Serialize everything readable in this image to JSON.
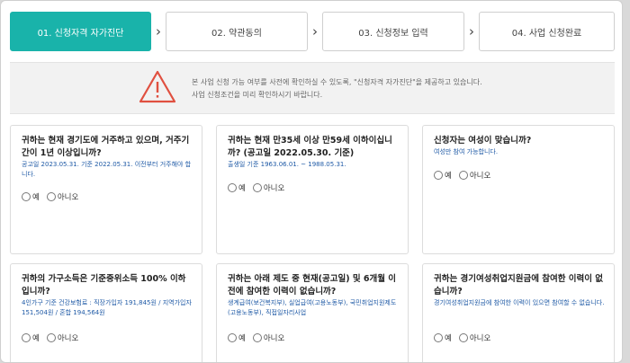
{
  "steps": [
    {
      "label": "01. 신청자격 자가진단",
      "active": true
    },
    {
      "label": "02. 약관동의",
      "active": false
    },
    {
      "label": "03. 신청정보 입력",
      "active": false
    },
    {
      "label": "04. 사업 신청완료",
      "active": false
    }
  ],
  "notice": {
    "line1": "본 사업 신청 가능 여부를 사전에 확인하실 수 있도록, \"신청자격 자가진단\"을 제공하고 있습니다.",
    "line2": "사업 신청조건을 미리 확인하시기 바랍니다.",
    "accent_color": "#e05040"
  },
  "questions": [
    {
      "title": "귀하는 현재 경기도에 거주하고 있으며, 거주기간이 1년 이상입니까?",
      "sub": "공고일 2023.05.31. 기준 2022.05.31. 이전부터 거주해야 합니다."
    },
    {
      "title": "귀하는 현재 만35세 이상 만59세 이하이십니까? (공고일 2022.05.30. 기준)",
      "sub": "출생일 기준 1963.06.01. ~ 1988.05.31."
    },
    {
      "title": "신청자는 여성이 맞습니까?",
      "sub": "여성만 참여 가능합니다."
    },
    {
      "title": "귀하의 가구소득은 기준중위소득 100% 이하입니까?",
      "sub": "4인가구 기준 건강보험료 : 직장가입자 191,845원 / 지역가입자 151,504원 / 혼합 194,564원"
    },
    {
      "title": "귀하는 아래 제도 중 현재(공고일) 및 6개월 이전에 참여한 이력이 없습니까?",
      "sub": "생계급여(보건복지부), 실업급여(고용노동부), 국민취업지원제도(고용노동부), 직접일자리사업"
    },
    {
      "title": "귀하는 경기여성취업지원금에 참여한 이력이 없습니까?",
      "sub": "경기여성취업지원금에 참여한 이력이 있으면 참여할 수 없습니다."
    }
  ],
  "options": {
    "yes": "예",
    "no": "아니오"
  }
}
